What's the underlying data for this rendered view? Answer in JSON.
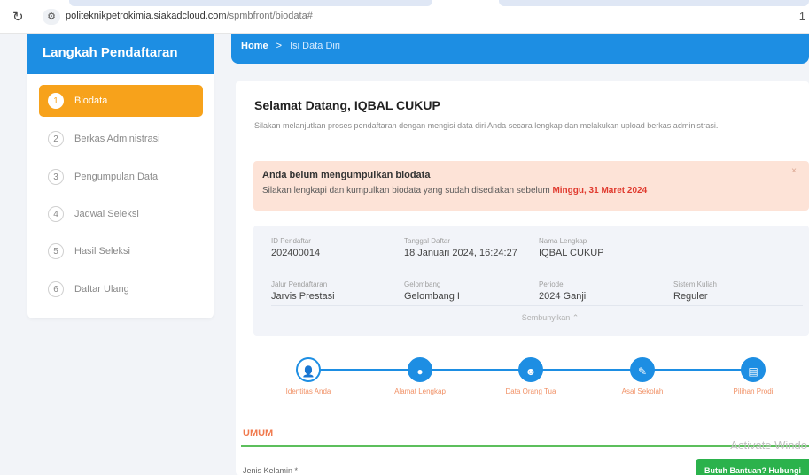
{
  "browser": {
    "reload_icon": "↻",
    "site_icon": "⚙",
    "url_host": "politeknikpetrokimia.siakadcloud.com",
    "url_path": "/spmbfront/biodata#",
    "right_glyph": "1"
  },
  "sidebar": {
    "title": "Langkah Pendaftaran",
    "items": [
      {
        "num": "1",
        "label": "Biodata",
        "active": true
      },
      {
        "num": "2",
        "label": "Berkas Administrasi"
      },
      {
        "num": "3",
        "label": "Pengumpulan Data"
      },
      {
        "num": "4",
        "label": "Jadwal Seleksi"
      },
      {
        "num": "5",
        "label": "Hasil Seleksi"
      },
      {
        "num": "6",
        "label": "Daftar Ulang"
      }
    ]
  },
  "breadcrumb": {
    "home": "Home",
    "separator": ">",
    "current": "Isi Data Diri"
  },
  "main": {
    "welcome": "Selamat Datang, IQBAL CUKUP",
    "intro": "Silakan melanjutkan proses pendaftaran dengan mengisi data diri Anda secara lengkap dan melakukan upload berkas administrasi.",
    "alert": {
      "title": "Anda belum mengumpulkan biodata",
      "text": "Silakan lengkapi dan kumpulkan biodata yang sudah disediakan sebelum ",
      "deadline": "Minggu, 31 Maret 2024",
      "close": "×"
    },
    "info": {
      "id_label": "ID Pendaftar",
      "id_value": "202400014",
      "date_label": "Tanggal Daftar",
      "date_value": "18 Januari 2024, 16:24:27",
      "name_label": "Nama Lengkap",
      "name_value": "IQBAL CUKUP",
      "jalur_label": "Jalur Pendaftaran",
      "jalur_value": "Jarvis Prestasi",
      "gel_label": "Gelombang",
      "gel_value": "Gelombang I",
      "periode_label": "Periode",
      "periode_value": "2024 Ganjil",
      "sistem_label": "Sistem Kuliah",
      "sistem_value": "Reguler",
      "toggle": "Sembunyikan ⌃"
    },
    "progress": [
      {
        "label": "Identitas Anda",
        "icon": "👤"
      },
      {
        "label": "Alamat Lengkap",
        "icon": "●"
      },
      {
        "label": "Data Orang Tua",
        "icon": "☻"
      },
      {
        "label": "Asal Sekolah",
        "icon": "✎"
      },
      {
        "label": "Pilihan Prodi",
        "icon": "▤"
      }
    ],
    "section_title": "UMUM",
    "field_label": "Jenis Kelamin *"
  },
  "overlay": {
    "watermark": "Activate Windo",
    "help": "Butuh Bantuan? Hubungi"
  },
  "colors": {
    "primary": "#1d8ee3",
    "orange": "#f7a21b",
    "alert_bg": "#fde3d7",
    "deadline": "#e03a2e",
    "green": "#2bb24c"
  }
}
